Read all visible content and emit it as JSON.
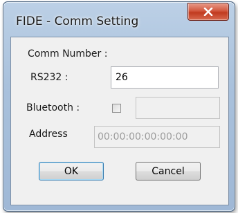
{
  "window": {
    "title": "FIDE - Comm Setting"
  },
  "icons": {
    "close": "close-icon"
  },
  "form": {
    "comm_number_label": "Comm Number :",
    "rs232_label": "RS232 :",
    "rs232_value": "26",
    "bluetooth_label": "Bluetooth :",
    "bluetooth_checked": false,
    "bluetooth_value": "",
    "address_label": "Address",
    "address_value": "00:00:00:00:00:00"
  },
  "buttons": {
    "ok": "OK",
    "cancel": "Cancel"
  },
  "colors": {
    "close_button": "#c8452a",
    "title_bar": "#a9c1dc",
    "client_bg": "#f0f0f0"
  }
}
